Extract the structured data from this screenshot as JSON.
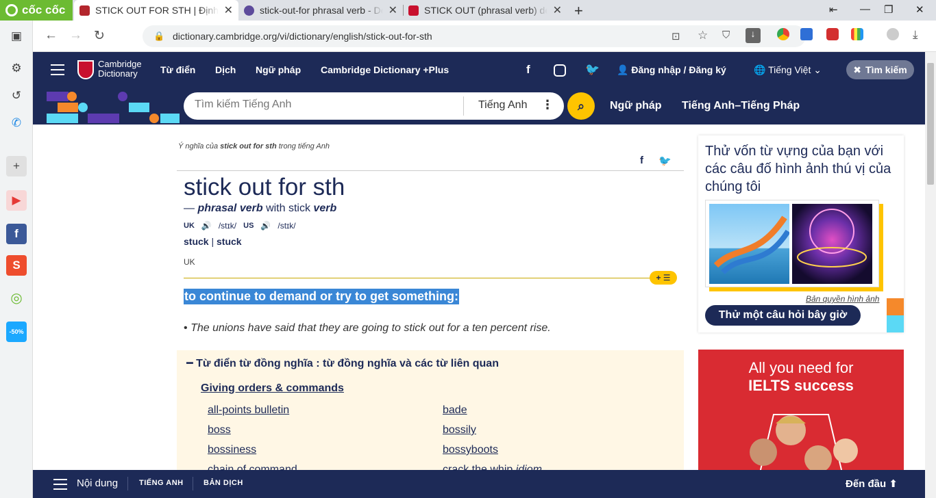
{
  "browser": {
    "logo": "cốc cốc",
    "tabs": [
      {
        "title": "STICK OUT FOR STH | Định nghĩa",
        "color": "#b3262d"
      },
      {
        "title": "stick-out-for phrasal verb - Definition",
        "color": "#5d4b9b"
      },
      {
        "title": "STICK OUT (phrasal verb) definition",
        "color": "#c8102e"
      }
    ],
    "url": "dictionary.cambridge.org/vi/dictionary/english/stick-out-for-sth"
  },
  "header": {
    "brand_line1": "Cambridge",
    "brand_line2": "Dictionary",
    "nav": [
      "Từ điển",
      "Dịch",
      "Ngữ pháp",
      "Cambridge Dictionary +Plus"
    ],
    "login": "Đăng nhập / Đăng ký",
    "language": "Tiếng Việt",
    "search_button": "Tìm kiếm"
  },
  "search": {
    "placeholder": "Tìm kiếm Tiếng Anh",
    "dictionary": "Tiếng Anh",
    "links": [
      "Ngữ pháp",
      "Tiếng Anh–Tiếng Pháp"
    ]
  },
  "entry": {
    "crumb_prefix": "Ý nghĩa của",
    "crumb_word": "stick out for sth",
    "crumb_suffix": "trong tiếng Anh",
    "headword": "stick out for sth",
    "pos_dash": "—",
    "pos": "phrasal verb",
    "pos_with": "with stick",
    "pos_verb": "verb",
    "uk_label": "UK",
    "uk_ipa": "/stɪk/",
    "us_label": "US",
    "us_ipa": "/stɪk/",
    "form1": "stuck",
    "form_sep": "|",
    "form2": "stuck",
    "region": "UK",
    "badge": "+ ☰",
    "definition": "to continue to demand or try to get something:",
    "example_bullet": "•",
    "example": "The unions have said that they are going to stick out for a ten percent rise."
  },
  "thesaurus": {
    "title": "Từ điển từ đồng nghĩa : từ đồng nghĩa và các từ liên quan",
    "category": "Giving orders & commands",
    "left_words": [
      "all-points bulletin",
      "boss",
      "bossiness",
      "chain of command"
    ],
    "right_words": [
      "bade",
      "bossily",
      "bossyboots",
      "crack the whip"
    ],
    "right_last_suffix": "idiom"
  },
  "sidebar_quiz": {
    "question": "Thử vốn từ vựng của bạn với các câu đố hình ảnh thú vị của chúng tôi",
    "copyright": "Bản quyền hình ảnh",
    "button": "Thử một câu hỏi bây giờ"
  },
  "ad": {
    "line1": "All you need for",
    "line2": "IELTS success"
  },
  "bottom": {
    "contents": "Nội dung",
    "tab1": "TIẾNG ANH",
    "tab2": "BẢN DỊCH",
    "top": "Đến đầu"
  },
  "colors": {
    "navy": "#1d2a57",
    "yellow": "#fec400",
    "highlight": "#3a87d6",
    "thesaurus_bg": "#fff7e5",
    "ad_red": "#d92b32"
  }
}
